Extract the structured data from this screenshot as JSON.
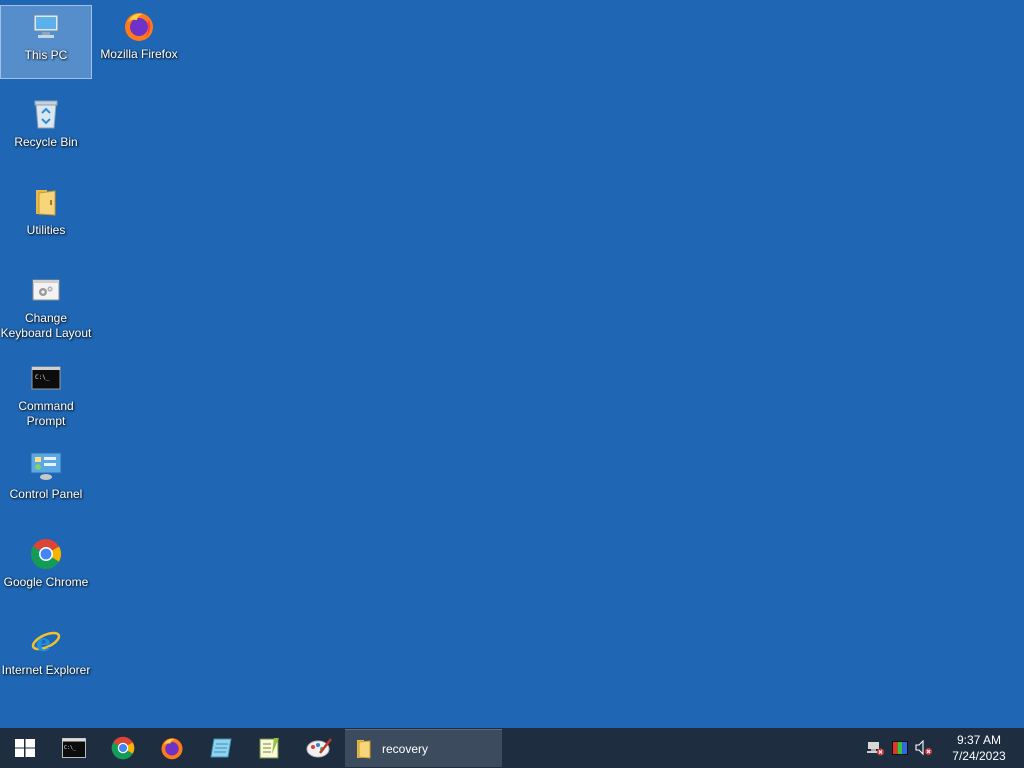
{
  "desktop_icons": [
    {
      "label": "This PC",
      "icon": "computer-icon"
    },
    {
      "label": "Mozilla Firefox",
      "icon": "firefox-icon"
    },
    {
      "label": "Recycle Bin",
      "icon": "recycle-bin-icon"
    },
    {
      "label": "Utilities",
      "icon": "folder-icon"
    },
    {
      "label": "Change\nKeyboard Layout",
      "icon": "keyboard-settings-icon"
    },
    {
      "label": "Command\nPrompt",
      "icon": "command-prompt-icon"
    },
    {
      "label": "Control Panel",
      "icon": "control-panel-icon"
    },
    {
      "label": "Google Chrome",
      "icon": "chrome-icon"
    },
    {
      "label": "Internet Explorer",
      "icon": "internet-explorer-icon"
    }
  ],
  "taskbar": {
    "pinned": [
      "start-icon",
      "command-prompt-icon",
      "chrome-icon",
      "firefox-icon",
      "notepad-icon",
      "notepad-plus-icon",
      "paint-icon"
    ],
    "open_window": {
      "label": "recovery",
      "icon": "folder-icon"
    },
    "tray_icons": [
      "network-error-icon",
      "color-display-icon",
      "volume-muted-icon"
    ],
    "clock": {
      "time": "9:37 AM",
      "date": "7/24/2023"
    }
  },
  "colors": {
    "desktop": "#1f67b4",
    "taskbar": "#1e2d3f"
  }
}
